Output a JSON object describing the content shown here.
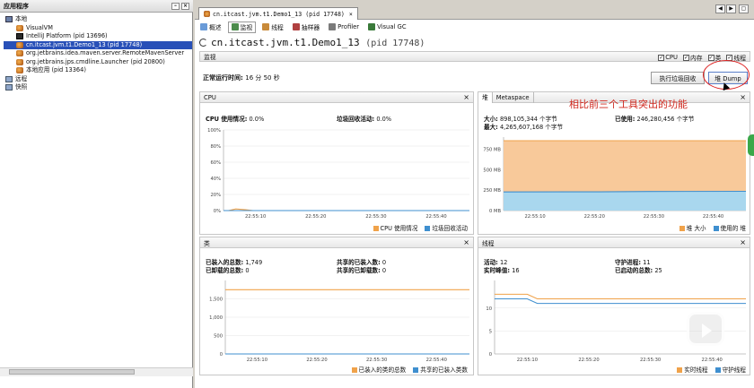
{
  "left": {
    "title": "应用程序",
    "tree": [
      {
        "label": "本地",
        "icon": "computer-icon",
        "indent": 0
      },
      {
        "label": "VisualVM",
        "icon": "java-cup-icon",
        "indent": 1
      },
      {
        "label": "IntelliJ Platform (pid 13696)",
        "icon": "intellij-icon",
        "indent": 1
      },
      {
        "label": "cn.itcast.jvm.t1.Demo1_13 (pid 17748)",
        "icon": "java-cup-icon",
        "indent": 1,
        "selected": true
      },
      {
        "label": "org.jetbrains.idea.maven.server.RemoteMavenServer",
        "icon": "java-cup-icon",
        "indent": 1
      },
      {
        "label": "org.jetbrains.jps.cmdline.Launcher (pid 20800)",
        "icon": "java-cup-icon",
        "indent": 1
      },
      {
        "label": "本地应用 (pid 13364)",
        "icon": "java-cup-icon",
        "indent": 1
      },
      {
        "label": "远程",
        "icon": "network-icon",
        "indent": 0
      },
      {
        "label": "快照",
        "icon": "snapshot-icon",
        "indent": 0
      }
    ]
  },
  "doc_tab": "cn.itcast.jvm.t1.Demo1_13 (pid 17748)",
  "sub_tabs": [
    "概述",
    "监视",
    "线程",
    "抽样器",
    "Profiler",
    "Visual GC"
  ],
  "title_main": "cn.itcast.jvm.t1.Demo1_13",
  "title_pid": "(pid 17748)",
  "monitor": {
    "label": "监视",
    "checks": [
      "CPU",
      "内存",
      "类",
      "线程"
    ],
    "uptime_label": "正常运行时间:",
    "uptime_value": "16 分 50 秒",
    "gc_button": "执行垃圾回收",
    "heap_dump_button": "堆 Dump"
  },
  "annotation": "相比前三个工具突出的功能",
  "cpu": {
    "title": "CPU",
    "usage_label": "CPU 使用情况:",
    "usage_value": "0.0%",
    "gc_label": "垃圾回收活动:",
    "gc_value": "0.0%",
    "legend": [
      "CPU 使用情况",
      "垃圾回收活动"
    ]
  },
  "heap": {
    "tabs": [
      "堆",
      "Metaspace"
    ],
    "size_label": "大小:",
    "size_value": "898,105,344 个字节",
    "used_label": "已使用:",
    "used_value": "246,280,456 个字节",
    "max_label": "最大:",
    "max_value": "4,265,607,168 个字节",
    "legend": [
      "堆 大小",
      "使用的 堆"
    ]
  },
  "classes": {
    "title": "类",
    "loaded_label": "已装入的总数:",
    "loaded_value": "1,749",
    "unloaded_label": "已卸载的总数:",
    "unloaded_value": "0",
    "shared_loaded_label": "共享的已装入数:",
    "shared_loaded_value": "0",
    "shared_unloaded_label": "共享的已卸载数:",
    "shared_unloaded_value": "0",
    "legend": [
      "已装入的类的总数",
      "共享的已装入类数"
    ]
  },
  "threads": {
    "title": "线程",
    "live_label": "活动:",
    "live_value": "12",
    "peak_label": "实时峰值:",
    "peak_value": "16",
    "daemon_label": "守护进程:",
    "daemon_value": "11",
    "started_label": "已启动的总数:",
    "started_value": "25",
    "legend": [
      "实时线程",
      "守护线程"
    ]
  },
  "colors": {
    "orange": "#f0a24a",
    "blue": "#3f8fcf",
    "selection": "#2850b8",
    "annotation": "#d0281e"
  },
  "chart_data": [
    {
      "type": "line",
      "title": "CPU",
      "x": [
        "22:55:10",
        "22:55:20",
        "22:55:30",
        "22:55:40"
      ],
      "yticks": [
        "100%",
        "80%",
        "60%",
        "40%",
        "20%",
        "0%"
      ],
      "ylim": [
        0,
        100
      ],
      "series": [
        {
          "name": "CPU 使用情况",
          "points": [
            [
              0,
              0
            ],
            [
              0.02,
              0
            ],
            [
              0.05,
              2
            ],
            [
              0.09,
              1
            ],
            [
              0.12,
              0
            ],
            [
              1,
              0
            ]
          ]
        },
        {
          "name": "垃圾回收活动",
          "points": [
            [
              0,
              0
            ],
            [
              1,
              0
            ]
          ]
        }
      ]
    },
    {
      "type": "area",
      "title": "堆",
      "x": [
        "22:55:10",
        "22:55:20",
        "22:55:30",
        "22:55:40"
      ],
      "yticks": [
        "750 MB",
        "500 MB",
        "250 MB",
        "0 MB"
      ],
      "ylim": [
        0,
        900
      ],
      "series": [
        {
          "name": "堆 大小",
          "points": [
            [
              0,
              856
            ],
            [
              1,
              856
            ]
          ]
        },
        {
          "name": "使用的 堆",
          "points": [
            [
              0,
              228
            ],
            [
              0.4,
              230
            ],
            [
              0.6,
              234
            ],
            [
              1,
              236
            ]
          ]
        }
      ]
    },
    {
      "type": "line",
      "title": "类",
      "x": [
        "22:55:10",
        "22:55:20",
        "22:55:30",
        "22:55:40"
      ],
      "yticks": [
        "1,500",
        "1,000",
        "500",
        "0"
      ],
      "ylim": [
        0,
        2000
      ],
      "series": [
        {
          "name": "已装入的类的总数",
          "points": [
            [
              0,
              1749
            ],
            [
              1,
              1749
            ]
          ]
        },
        {
          "name": "共享的已装入类数",
          "points": [
            [
              0,
              0
            ],
            [
              1,
              0
            ]
          ]
        }
      ]
    },
    {
      "type": "line",
      "title": "线程",
      "x": [
        "22:55:10",
        "22:55:20",
        "22:55:30",
        "22:55:40"
      ],
      "yticks": [
        "10",
        "5",
        "0"
      ],
      "ylim": [
        0,
        16
      ],
      "series": [
        {
          "name": "实时线程",
          "points": [
            [
              0,
              13
            ],
            [
              0.13,
              13
            ],
            [
              0.17,
              12
            ],
            [
              1,
              12
            ]
          ]
        },
        {
          "name": "守护线程",
          "points": [
            [
              0,
              12
            ],
            [
              0.13,
              12
            ],
            [
              0.17,
              11
            ],
            [
              1,
              11
            ]
          ]
        }
      ]
    }
  ]
}
